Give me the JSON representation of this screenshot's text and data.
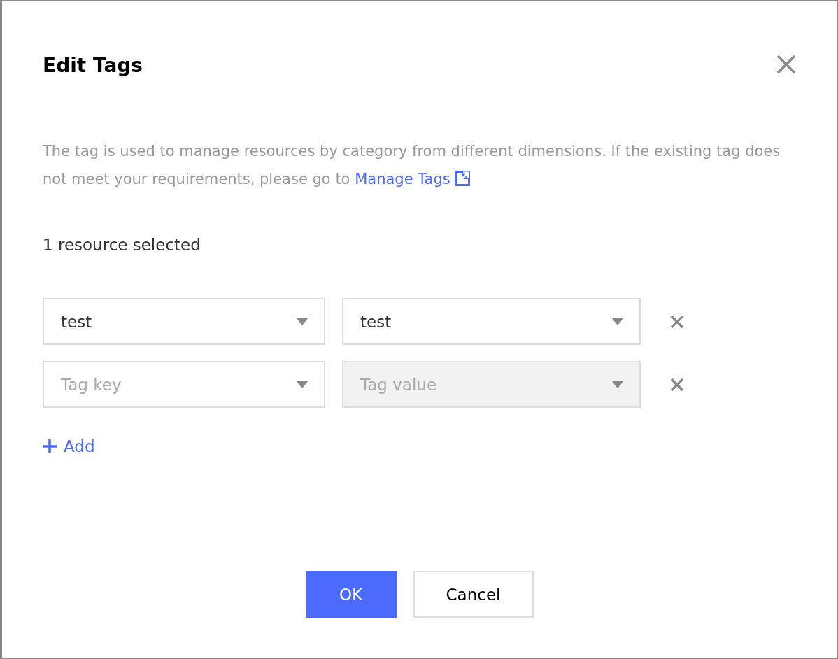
{
  "dialog": {
    "title": "Edit Tags",
    "description": "The tag is used to manage resources by category from different dimensions. If the existing tag does not meet your requirements, please go to ",
    "link": "Manage Tags",
    "selection_count": "1 resource selected",
    "tag_rows": [
      {
        "key": {
          "value": "test",
          "disabled": false
        },
        "value": {
          "value": "test",
          "disabled": false
        }
      },
      {
        "key": {
          "placeholder": "Tag key",
          "disabled": false
        },
        "value": {
          "placeholder": "Tag value",
          "disabled": true
        }
      }
    ],
    "add_label": "Add",
    "buttons": [
      {
        "label": "OK",
        "kind": "primary"
      },
      {
        "label": "Cancel",
        "kind": "secondary"
      }
    ]
  }
}
